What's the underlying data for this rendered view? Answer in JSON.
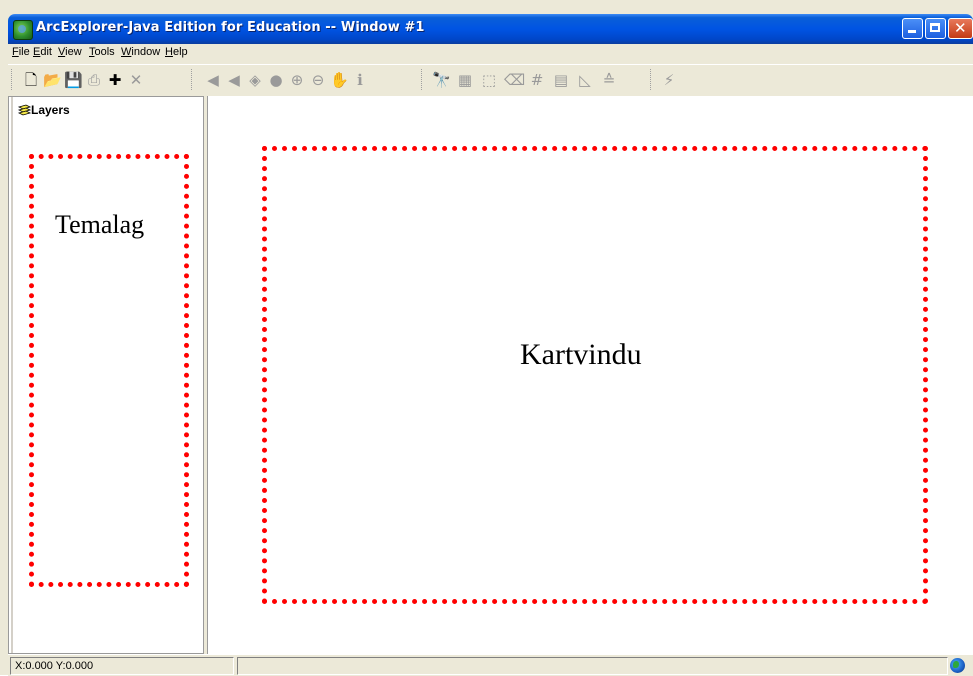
{
  "window": {
    "title": "ArcExplorer-Java Edition for Education -- Window #1"
  },
  "menu": {
    "items": [
      "File",
      "Edit",
      "View",
      "Tools",
      "Window",
      "Help"
    ]
  },
  "toolbar": {
    "buttons": [
      {
        "name": "new-icon",
        "glyph": "🗋",
        "state": "active"
      },
      {
        "name": "open-folder-icon",
        "glyph": "📂",
        "state": "active"
      },
      {
        "name": "save-icon",
        "glyph": "💾",
        "state": "disabled"
      },
      {
        "name": "print-icon",
        "glyph": "⎙",
        "state": "disabled"
      },
      {
        "name": "add-layer-icon",
        "glyph": "✚",
        "state": "active"
      },
      {
        "name": "remove-layer-icon",
        "glyph": "✕",
        "state": "disabled"
      },
      {
        "name": "zoom-previous-icon",
        "glyph": "◀",
        "state": "disabled"
      },
      {
        "name": "zoom-next-icon",
        "glyph": "◀",
        "state": "disabled"
      },
      {
        "name": "zoom-full-extent-icon",
        "glyph": "◈",
        "state": "disabled"
      },
      {
        "name": "zoom-layer-icon",
        "glyph": "●",
        "state": "disabled"
      },
      {
        "name": "zoom-in-icon",
        "glyph": "⊕",
        "state": "disabled"
      },
      {
        "name": "zoom-out-icon",
        "glyph": "⊖",
        "state": "disabled"
      },
      {
        "name": "pan-icon",
        "glyph": "✋",
        "state": "disabled"
      },
      {
        "name": "identify-icon",
        "glyph": "ℹ",
        "state": "disabled"
      },
      {
        "name": "find-icon",
        "glyph": "🔭",
        "state": "disabled"
      },
      {
        "name": "select-features-icon",
        "glyph": "▦",
        "state": "disabled"
      },
      {
        "name": "select-box-icon",
        "glyph": "⬚",
        "state": "disabled"
      },
      {
        "name": "clear-selection-icon",
        "glyph": "⌫",
        "state": "disabled"
      },
      {
        "name": "query-builder-icon",
        "glyph": "#",
        "state": "disabled"
      },
      {
        "name": "attribute-table-icon",
        "glyph": "▤",
        "state": "disabled"
      },
      {
        "name": "measure-icon",
        "glyph": "◺",
        "state": "disabled"
      },
      {
        "name": "buffer-icon",
        "glyph": "≙",
        "state": "disabled"
      },
      {
        "name": "hotlink-icon",
        "glyph": "⚡",
        "state": "disabled"
      }
    ]
  },
  "layers_panel": {
    "header": "Layers",
    "annotation": "Temalag"
  },
  "map_view": {
    "annotation": "Kartvindu"
  },
  "statusbar": {
    "coordinates": "X:0.000 Y:0.000"
  },
  "colors": {
    "annotation_frame": "#ff0000",
    "titlebar": "#0054e3",
    "chrome": "#ece9d8"
  }
}
